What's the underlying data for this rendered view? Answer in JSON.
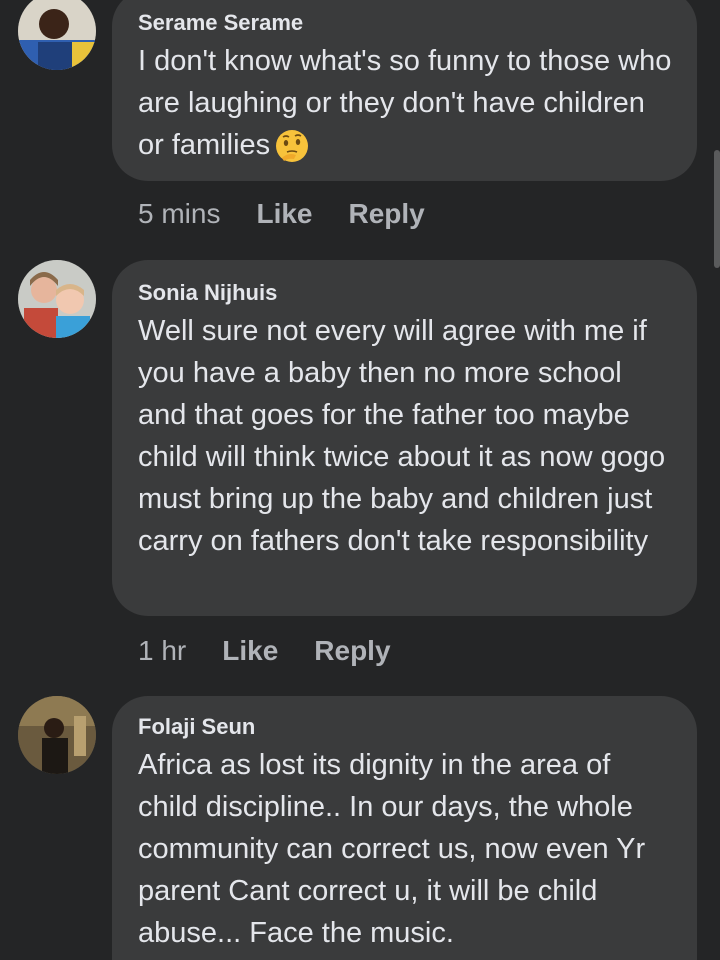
{
  "comments": [
    {
      "author": "Serame Serame",
      "text": "I don't know what's so funny to those who are laughing or they don't have children or families",
      "emoji": "thinking-face-emoji",
      "time": "5 mins",
      "like_label": "Like",
      "reply_label": "Reply"
    },
    {
      "author": "Sonia Nijhuis",
      "text": "Well sure not every will agree with me if you have a baby then no more school and that goes for the father too maybe child will think twice about it as now gogo must bring up the baby and children just carry on fathers don't take responsibility",
      "time": "1 hr",
      "like_label": "Like",
      "reply_label": "Reply"
    },
    {
      "author": "Folaji Seun",
      "text": "Africa as lost its dignity in the area of child discipline.. In our days, the whole community can correct us, now even Yr parent Cant correct u, it will be child abuse... Face the music."
    }
  ],
  "colors": {
    "background": "#242526",
    "bubble": "#3a3b3c",
    "text": "#e4e6eb",
    "secondary": "#b0b3b8"
  }
}
